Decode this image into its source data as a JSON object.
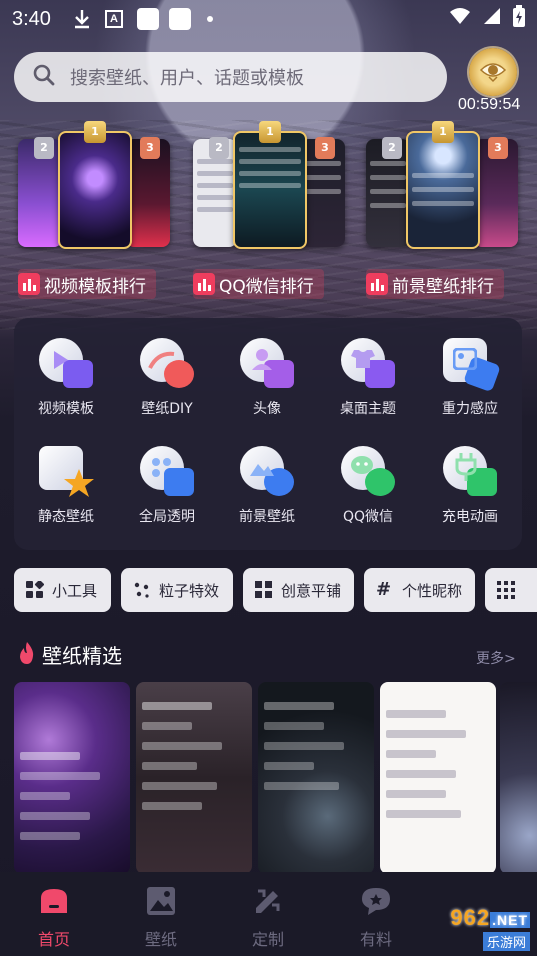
{
  "status_bar": {
    "time": "3:40",
    "icons": [
      "download-icon",
      "a-icon",
      "notification-square-icon",
      "notification-square-icon",
      "dot-icon",
      "wifi-icon",
      "signal-icon",
      "battery-charging-icon"
    ]
  },
  "search": {
    "placeholder": "搜索壁纸、用户、话题或模板"
  },
  "badge": {
    "icon": "eye-badge-icon",
    "timer": "00:59:54"
  },
  "rankings": [
    {
      "label": "视频模板排行",
      "medals": [
        "1",
        "2",
        "3"
      ]
    },
    {
      "label": "QQ微信排行",
      "medals": [
        "1",
        "2",
        "3"
      ]
    },
    {
      "label": "前景壁纸排行",
      "medals": [
        "1",
        "2",
        "3"
      ]
    }
  ],
  "features": [
    {
      "label": "视频模板",
      "icon": "video-template-icon",
      "color": "#7b5cf0"
    },
    {
      "label": "壁纸DIY",
      "icon": "wallpaper-diy-icon",
      "color": "#f05a5a"
    },
    {
      "label": "头像",
      "icon": "avatar-icon",
      "color": "#a45ee8"
    },
    {
      "label": "桌面主题",
      "icon": "desktop-theme-icon",
      "color": "#8a5af0"
    },
    {
      "label": "重力感应",
      "icon": "gravity-sensor-icon",
      "color": "#3d7cf0"
    },
    {
      "label": "静态壁纸",
      "icon": "static-wallpaper-icon",
      "color": "#f5a623"
    },
    {
      "label": "全局透明",
      "icon": "global-transparent-icon",
      "color": "#3d7cf0"
    },
    {
      "label": "前景壁纸",
      "icon": "foreground-wallpaper-icon",
      "color": "#3d7cf0"
    },
    {
      "label": "QQ微信",
      "icon": "qq-wechat-icon",
      "color": "#2fc46a"
    },
    {
      "label": "充电动画",
      "icon": "charging-animation-icon",
      "color": "#2fc46a"
    }
  ],
  "tools": [
    {
      "label": "小工具",
      "icon": "widgets-icon"
    },
    {
      "label": "粒子特效",
      "icon": "particles-icon"
    },
    {
      "label": "创意平铺",
      "icon": "tile-icon"
    },
    {
      "label": "个性昵称",
      "icon": "hash-icon"
    },
    {
      "label": "",
      "icon": "grid-icon"
    }
  ],
  "section": {
    "title": "壁纸精选",
    "more": "更多>"
  },
  "nav": {
    "items": [
      {
        "label": "首页",
        "icon": "home-icon",
        "active": true
      },
      {
        "label": "壁纸",
        "icon": "image-icon",
        "active": false
      },
      {
        "label": "定制",
        "icon": "customize-icon",
        "active": false
      },
      {
        "label": "有料",
        "icon": "chat-icon",
        "active": false
      }
    ]
  },
  "watermark": {
    "text1": "962",
    "text1_suffix": ".NET",
    "text2": "乐游网"
  }
}
